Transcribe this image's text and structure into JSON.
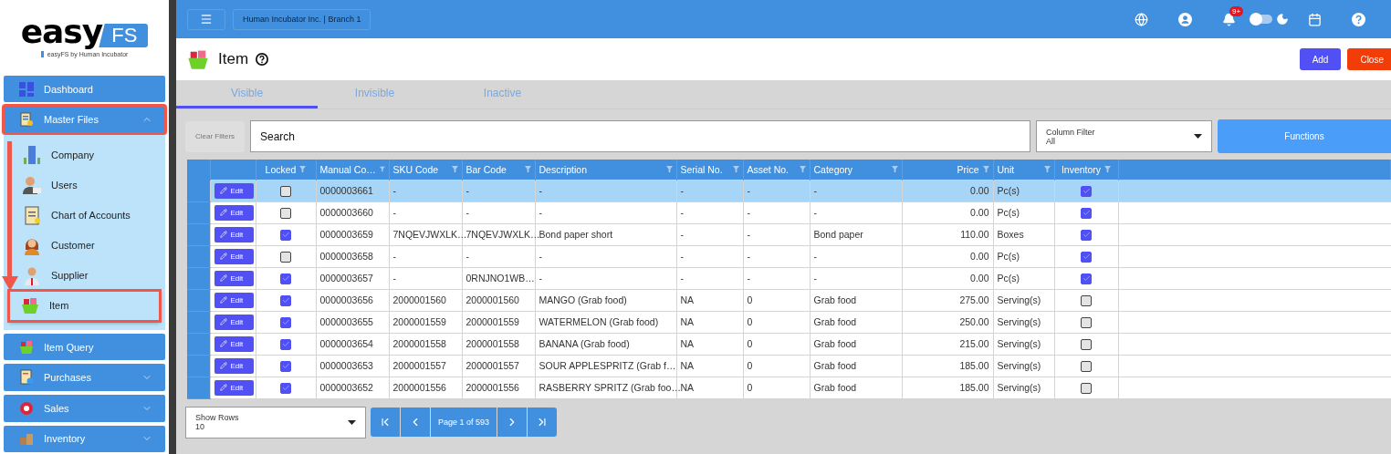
{
  "sidebar": {
    "logo": {
      "word": "easy",
      "badge": "FS",
      "tagline": "easyFS by Human Incubator"
    },
    "items": [
      {
        "label": "Dashboard",
        "expandable": false,
        "expanded": false,
        "annotated": false
      },
      {
        "label": "Master Files",
        "expandable": true,
        "expanded": true,
        "annotated": true,
        "children": [
          {
            "label": "Company",
            "annotated": false
          },
          {
            "label": "Users",
            "annotated": false
          },
          {
            "label": "Chart of Accounts",
            "annotated": false
          },
          {
            "label": "Customer",
            "annotated": false
          },
          {
            "label": "Supplier",
            "annotated": false
          },
          {
            "label": "Item",
            "annotated": true
          }
        ]
      },
      {
        "label": "Item Query",
        "expandable": false,
        "expanded": false,
        "annotated": false
      },
      {
        "label": "Purchases",
        "expandable": true,
        "expanded": false,
        "annotated": false
      },
      {
        "label": "Sales",
        "expandable": true,
        "expanded": false,
        "annotated": false
      },
      {
        "label": "Inventory",
        "expandable": true,
        "expanded": false,
        "annotated": false
      }
    ]
  },
  "topbar": {
    "branch": "Human Incubator Inc. | Branch 1",
    "notification_count": "9+",
    "dark_mode": {
      "on": false
    }
  },
  "page": {
    "title": "Item",
    "buttons": [
      {
        "label": "Add",
        "kind": "primary"
      },
      {
        "label": "Close",
        "kind": "danger"
      }
    ]
  },
  "tabs": [
    {
      "label": "Visible",
      "selected": true
    },
    {
      "label": "Invisible",
      "selected": false
    },
    {
      "label": "Inactive",
      "selected": false
    }
  ],
  "filters": {
    "clear": {
      "label": "Clear Filters",
      "disabled": true
    },
    "search": {
      "placeholder": "Search"
    },
    "column_filter": {
      "label": "Column Filter",
      "value": "All"
    },
    "functions": "Functions"
  },
  "table": {
    "columns": [
      {
        "kind": "actions"
      },
      {
        "kind": "check",
        "label": "Locked"
      },
      {
        "kind": "text",
        "label": "Manual Co…"
      },
      {
        "kind": "text",
        "label": "SKU Code"
      },
      {
        "kind": "text",
        "label": "Bar Code"
      },
      {
        "kind": "text",
        "label": "Description"
      },
      {
        "kind": "text",
        "label": "Serial No."
      },
      {
        "kind": "text",
        "label": "Asset No."
      },
      {
        "kind": "text",
        "label": "Category"
      },
      {
        "kind": "number",
        "label": "Price"
      },
      {
        "kind": "text",
        "label": "Unit"
      },
      {
        "kind": "check",
        "label": "Inventory"
      }
    ],
    "rows": [
      {
        "selected": true,
        "cells": [
          {
            "kind": "button",
            "text": "Edit"
          },
          {
            "kind": "check",
            "checked": false
          },
          {
            "kind": "text",
            "text": "0000003661"
          },
          {
            "kind": "text",
            "text": "-"
          },
          {
            "kind": "text",
            "text": "-"
          },
          {
            "kind": "text",
            "text": "-"
          },
          {
            "kind": "text",
            "text": "-"
          },
          {
            "kind": "text",
            "text": "-"
          },
          {
            "kind": "text",
            "text": "-"
          },
          {
            "kind": "text",
            "text": "0.00"
          },
          {
            "kind": "text",
            "text": "Pc(s)"
          },
          {
            "kind": "check",
            "checked": true
          }
        ]
      },
      {
        "selected": false,
        "cells": [
          {
            "kind": "button",
            "text": "Edit"
          },
          {
            "kind": "check",
            "checked": false
          },
          {
            "kind": "text",
            "text": "0000003660"
          },
          {
            "kind": "text",
            "text": "-"
          },
          {
            "kind": "text",
            "text": "-"
          },
          {
            "kind": "text",
            "text": "-"
          },
          {
            "kind": "text",
            "text": "-"
          },
          {
            "kind": "text",
            "text": "-"
          },
          {
            "kind": "text",
            "text": "-"
          },
          {
            "kind": "text",
            "text": "0.00"
          },
          {
            "kind": "text",
            "text": "Pc(s)"
          },
          {
            "kind": "check",
            "checked": true
          }
        ]
      },
      {
        "selected": false,
        "cells": [
          {
            "kind": "button",
            "text": "Edit"
          },
          {
            "kind": "check",
            "checked": true
          },
          {
            "kind": "text",
            "text": "0000003659"
          },
          {
            "kind": "text",
            "text": "7NQEVJWXLK…"
          },
          {
            "kind": "text",
            "text": "7NQEVJWXLK…"
          },
          {
            "kind": "text",
            "text": "Bond paper short"
          },
          {
            "kind": "text",
            "text": "-"
          },
          {
            "kind": "text",
            "text": "-"
          },
          {
            "kind": "text",
            "text": "Bond paper"
          },
          {
            "kind": "text",
            "text": "110.00"
          },
          {
            "kind": "text",
            "text": "Boxes"
          },
          {
            "kind": "check",
            "checked": true
          }
        ]
      },
      {
        "selected": false,
        "cells": [
          {
            "kind": "button",
            "text": "Edit"
          },
          {
            "kind": "check",
            "checked": false
          },
          {
            "kind": "text",
            "text": "0000003658"
          },
          {
            "kind": "text",
            "text": "-"
          },
          {
            "kind": "text",
            "text": "-"
          },
          {
            "kind": "text",
            "text": "-"
          },
          {
            "kind": "text",
            "text": "-"
          },
          {
            "kind": "text",
            "text": "-"
          },
          {
            "kind": "text",
            "text": "-"
          },
          {
            "kind": "text",
            "text": "0.00"
          },
          {
            "kind": "text",
            "text": "Pc(s)"
          },
          {
            "kind": "check",
            "checked": true
          }
        ]
      },
      {
        "selected": false,
        "cells": [
          {
            "kind": "button",
            "text": "Edit"
          },
          {
            "kind": "check",
            "checked": true
          },
          {
            "kind": "text",
            "text": "0000003657"
          },
          {
            "kind": "text",
            "text": "-"
          },
          {
            "kind": "text",
            "text": "0RNJNO1WB…"
          },
          {
            "kind": "text",
            "text": "-"
          },
          {
            "kind": "text",
            "text": "-"
          },
          {
            "kind": "text",
            "text": "-"
          },
          {
            "kind": "text",
            "text": "-"
          },
          {
            "kind": "text",
            "text": "0.00"
          },
          {
            "kind": "text",
            "text": "Pc(s)"
          },
          {
            "kind": "check",
            "checked": true
          }
        ]
      },
      {
        "selected": false,
        "cells": [
          {
            "kind": "button",
            "text": "Edit"
          },
          {
            "kind": "check",
            "checked": true
          },
          {
            "kind": "text",
            "text": "0000003656"
          },
          {
            "kind": "text",
            "text": "2000001560"
          },
          {
            "kind": "text",
            "text": "2000001560"
          },
          {
            "kind": "text",
            "text": "MANGO (Grab food)"
          },
          {
            "kind": "text",
            "text": "NA"
          },
          {
            "kind": "text",
            "text": "0"
          },
          {
            "kind": "text",
            "text": "Grab food"
          },
          {
            "kind": "text",
            "text": "275.00"
          },
          {
            "kind": "text",
            "text": "Serving(s)"
          },
          {
            "kind": "check",
            "checked": false
          }
        ]
      },
      {
        "selected": false,
        "cells": [
          {
            "kind": "button",
            "text": "Edit"
          },
          {
            "kind": "check",
            "checked": true
          },
          {
            "kind": "text",
            "text": "0000003655"
          },
          {
            "kind": "text",
            "text": "2000001559"
          },
          {
            "kind": "text",
            "text": "2000001559"
          },
          {
            "kind": "text",
            "text": "WATERMELON (Grab food)"
          },
          {
            "kind": "text",
            "text": "NA"
          },
          {
            "kind": "text",
            "text": "0"
          },
          {
            "kind": "text",
            "text": "Grab food"
          },
          {
            "kind": "text",
            "text": "250.00"
          },
          {
            "kind": "text",
            "text": "Serving(s)"
          },
          {
            "kind": "check",
            "checked": false
          }
        ]
      },
      {
        "selected": false,
        "cells": [
          {
            "kind": "button",
            "text": "Edit"
          },
          {
            "kind": "check",
            "checked": true
          },
          {
            "kind": "text",
            "text": "0000003654"
          },
          {
            "kind": "text",
            "text": "2000001558"
          },
          {
            "kind": "text",
            "text": "2000001558"
          },
          {
            "kind": "text",
            "text": "BANANA (Grab food)"
          },
          {
            "kind": "text",
            "text": "NA"
          },
          {
            "kind": "text",
            "text": "0"
          },
          {
            "kind": "text",
            "text": "Grab food"
          },
          {
            "kind": "text",
            "text": "215.00"
          },
          {
            "kind": "text",
            "text": "Serving(s)"
          },
          {
            "kind": "check",
            "checked": false
          }
        ]
      },
      {
        "selected": false,
        "cells": [
          {
            "kind": "button",
            "text": "Edit"
          },
          {
            "kind": "check",
            "checked": true
          },
          {
            "kind": "text",
            "text": "0000003653"
          },
          {
            "kind": "text",
            "text": "2000001557"
          },
          {
            "kind": "text",
            "text": "2000001557"
          },
          {
            "kind": "text",
            "text": "SOUR APPLESPRITZ (Grab f…"
          },
          {
            "kind": "text",
            "text": "NA"
          },
          {
            "kind": "text",
            "text": "0"
          },
          {
            "kind": "text",
            "text": "Grab food"
          },
          {
            "kind": "text",
            "text": "185.00"
          },
          {
            "kind": "text",
            "text": "Serving(s)"
          },
          {
            "kind": "check",
            "checked": false
          }
        ]
      },
      {
        "selected": false,
        "cells": [
          {
            "kind": "button",
            "text": "Edit"
          },
          {
            "kind": "check",
            "checked": true
          },
          {
            "kind": "text",
            "text": "0000003652"
          },
          {
            "kind": "text",
            "text": "2000001556"
          },
          {
            "kind": "text",
            "text": "2000001556"
          },
          {
            "kind": "text",
            "text": "RASBERRY SPRITZ (Grab foo…"
          },
          {
            "kind": "text",
            "text": "NA"
          },
          {
            "kind": "text",
            "text": "0"
          },
          {
            "kind": "text",
            "text": "Grab food"
          },
          {
            "kind": "text",
            "text": "185.00"
          },
          {
            "kind": "text",
            "text": "Serving(s)"
          },
          {
            "kind": "check",
            "checked": false
          }
        ]
      }
    ]
  },
  "pagination": {
    "show_rows": {
      "label": "Show Rows",
      "value": "10"
    },
    "page": "Page 1 of 593"
  }
}
